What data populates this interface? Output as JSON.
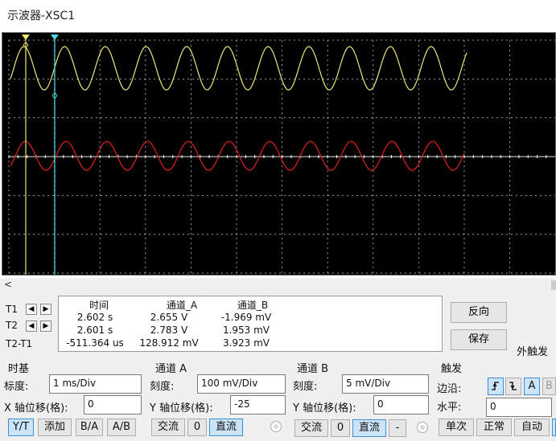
{
  "window": {
    "title": "示波器-XSC1"
  },
  "cursors": [
    {
      "label": "T1"
    },
    {
      "label": "T2"
    },
    {
      "label": "T2-T1"
    }
  ],
  "measurements": {
    "headers": [
      "时间",
      "通道_A",
      "通道_B"
    ],
    "rows": [
      [
        "2.602 s",
        "2.655 V",
        "-1.969 mV"
      ],
      [
        "2.601 s",
        "2.783 V",
        "1.953 mV"
      ],
      [
        "-511.364 us",
        "128.912 mV",
        "3.923 mV"
      ]
    ]
  },
  "actions": {
    "reverse": "反向",
    "save": "保存",
    "ext_trigger": "外触发"
  },
  "timebase": {
    "title": "时基",
    "scale_label": "标度:",
    "scale_value": "1 ms/Div",
    "xpos_label": "X 轴位移(格):",
    "xpos_value": "0",
    "modes": [
      "Y/T",
      "添加",
      "B/A",
      "A/B"
    ],
    "selected_mode": "Y/T"
  },
  "channel_a": {
    "title": "通道 A",
    "scale_label": "刻度:",
    "scale_value": "100 mV/Div",
    "ypos_label": "Y 轴位移(格):",
    "ypos_value": "-25",
    "coupling": [
      "交流",
      "0",
      "直流"
    ],
    "selected_coupling": "直流"
  },
  "channel_b": {
    "title": "通道 B",
    "scale_label": "刻度:",
    "scale_value": "5 mV/Div",
    "ypos_label": "Y 轴位移(格):",
    "ypos_value": "0",
    "coupling": [
      "交流",
      "0",
      "直流",
      "-"
    ],
    "selected_coupling": "直流"
  },
  "trigger": {
    "title": "触发",
    "edge_label": "边沿:",
    "level_label": "水平:",
    "level_value": "0",
    "source_buttons": [
      "A",
      "B"
    ],
    "selected_source": "A",
    "modes": [
      "单次",
      "正常",
      "自动"
    ]
  },
  "colors": {
    "channel_a": "#ece87a",
    "channel_b": "#e02020",
    "cursor_t1": "#f2e96a",
    "cursor_t2": "#48e0e8",
    "grid": "#cfcfcf"
  }
}
